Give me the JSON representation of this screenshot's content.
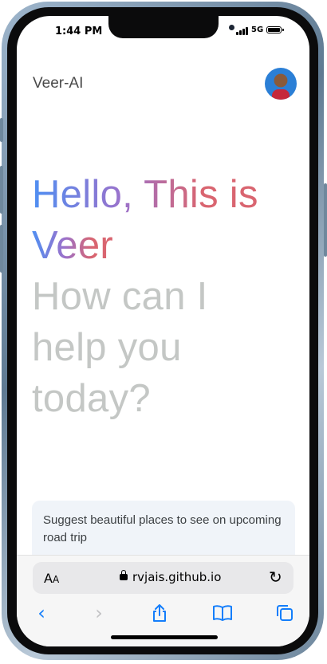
{
  "status_bar": {
    "time": "1:44 PM",
    "network": "5G"
  },
  "header": {
    "title": "Veer-AI",
    "avatar_alt": "user-avatar"
  },
  "greeting": {
    "line1": "Hello, This is",
    "line2": "Veer",
    "line3": "How can I help you today?"
  },
  "suggestions": [
    {
      "text": "Suggest beautiful places to see on upcoming road trip"
    }
  ],
  "browser": {
    "text_size_label": "A",
    "text_size_small": "A",
    "url": "rvjais.github.io"
  },
  "colors": {
    "accent": "#147efb",
    "gradient": [
      "#4f8ff2",
      "#9b72cb",
      "#d96570"
    ],
    "muted_text": "#c4c7c5"
  },
  "icons": [
    "lock-icon",
    "reload-icon",
    "back-icon",
    "forward-icon",
    "share-icon",
    "bookmarks-icon",
    "tabs-icon"
  ]
}
